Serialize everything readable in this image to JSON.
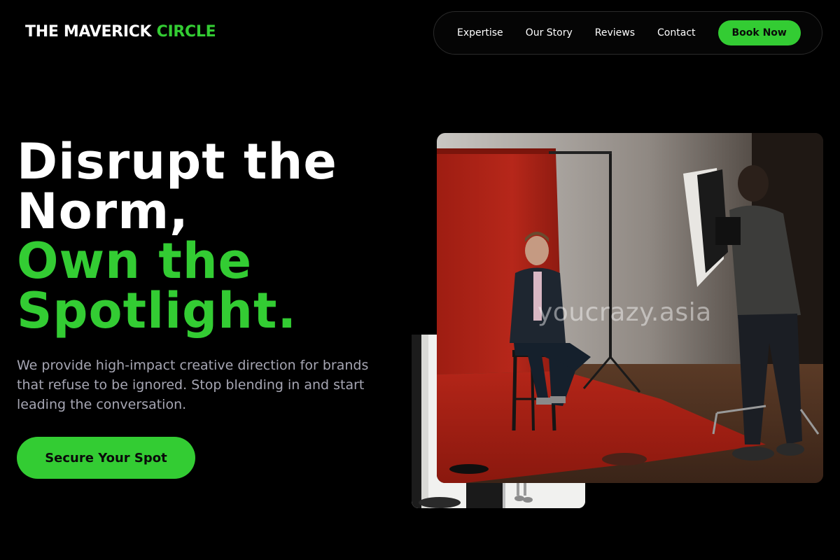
{
  "header": {
    "logo_part1": "THE MAVERICK",
    "logo_part2": "CIRCLE",
    "nav": {
      "links": [
        "Expertise",
        "Our Story",
        "Reviews",
        "Contact"
      ],
      "cta_label": "Book Now"
    }
  },
  "hero": {
    "headline_line1": "Disrupt the",
    "headline_line2": "Norm,",
    "headline_line3": "Own the",
    "headline_line4": "Spotlight.",
    "subtext": "We provide high-impact creative direction for brands that refuse to be ignored. Stop blending in and start leading the conversation.",
    "cta_label": "Secure Your Spot"
  },
  "images": {
    "watermark": "youcrazy.asia",
    "main_photo": "photo-studio-portrait-session",
    "secondary_photo": "photo-studio-backdrop"
  },
  "colors": {
    "background": "#000000",
    "accent": "#33cc33",
    "muted_text": "#a6a6b3"
  }
}
